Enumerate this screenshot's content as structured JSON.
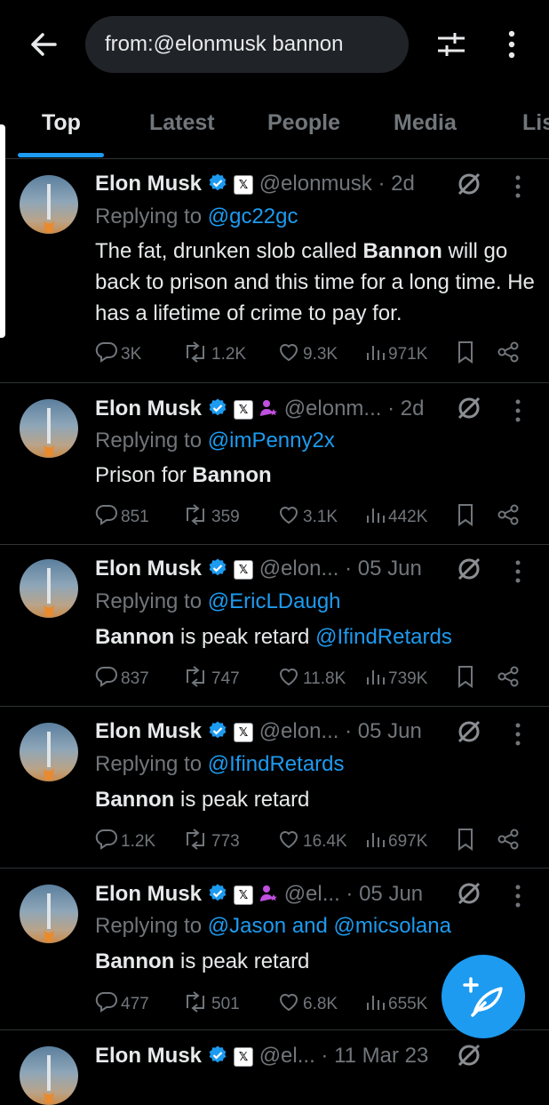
{
  "search": {
    "query": "from:@elonmusk bannon"
  },
  "tabs": [
    "Top",
    "Latest",
    "People",
    "Media",
    "Lis"
  ],
  "colors": {
    "accent": "#1d9bf0",
    "background": "#000000",
    "muted": "#71767b",
    "purple_badge": "#c050e0"
  },
  "tweets": [
    {
      "name": "Elon Musk",
      "handle": "@elonmusk",
      "dot": "·",
      "date": "2d",
      "replying_prefix": "Replying to",
      "replying_to": "@gc22gc",
      "body": [
        {
          "text": "The fat, drunken slob called ",
          "style": "normal"
        },
        {
          "text": "Bannon",
          "style": "bold"
        },
        {
          "text": " will go back to prison and this time for a long time. He has a lifetime of crime to pay for.",
          "style": "normal"
        }
      ],
      "stats": {
        "replies": "3K",
        "reposts": "1.2K",
        "likes": "9.3K",
        "views": "971K"
      }
    },
    {
      "name": "Elon Musk",
      "handle": "@elonm...",
      "dot": "·",
      "date": "2d",
      "replying_prefix": "Replying to",
      "replying_to": "@imPenny2x",
      "body": [
        {
          "text": "Prison for ",
          "style": "normal"
        },
        {
          "text": "Bannon",
          "style": "bold"
        }
      ],
      "stats": {
        "replies": "851",
        "reposts": "359",
        "likes": "3.1K",
        "views": "442K"
      }
    },
    {
      "name": "Elon Musk",
      "handle": "@elon...",
      "dot": "·",
      "date": "05 Jun",
      "replying_prefix": "Replying to",
      "replying_to": "@EricLDaugh",
      "body": [
        {
          "text": "Bannon",
          "style": "bold"
        },
        {
          "text": " is peak retard ",
          "style": "normal"
        },
        {
          "text": "@IfindRetards",
          "style": "link"
        }
      ],
      "stats": {
        "replies": "837",
        "reposts": "747",
        "likes": "11.8K",
        "views": "739K"
      }
    },
    {
      "name": "Elon Musk",
      "handle": "@elon...",
      "dot": "·",
      "date": "05 Jun",
      "replying_prefix": "Replying to",
      "replying_to": "@IfindRetards",
      "body": [
        {
          "text": "Bannon",
          "style": "bold"
        },
        {
          "text": " is peak retard",
          "style": "normal"
        }
      ],
      "stats": {
        "replies": "1.2K",
        "reposts": "773",
        "likes": "16.4K",
        "views": "697K"
      }
    },
    {
      "name": "Elon Musk",
      "handle": "@el...",
      "dot": "·",
      "date": "05 Jun",
      "replying_prefix": "Replying to",
      "replying_to": "@Jason and @micsolana",
      "body": [
        {
          "text": "Bannon",
          "style": "bold"
        },
        {
          "text": " is peak retard",
          "style": "normal"
        }
      ],
      "stats": {
        "replies": "477",
        "reposts": "501",
        "likes": "6.8K",
        "views": "655K"
      }
    },
    {
      "name": "Elon Musk",
      "handle": "@el...",
      "dot": "·",
      "date": "11 Mar 23"
    }
  ]
}
